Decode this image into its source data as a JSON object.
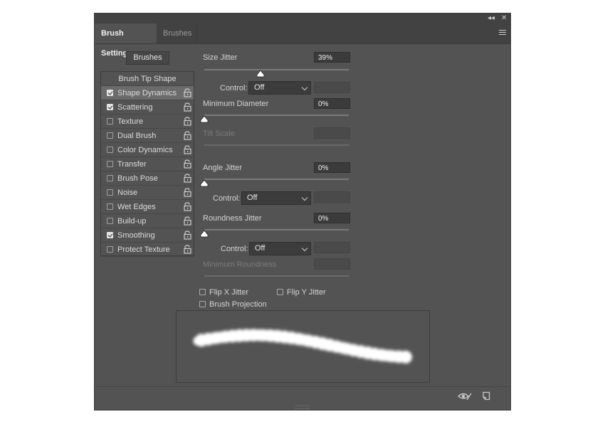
{
  "window": {
    "collapse_glyph": "◂◂",
    "close_glyph": "✕"
  },
  "tabs": [
    {
      "label": "Brush Settings",
      "active": true
    },
    {
      "label": "Brushes",
      "active": false
    }
  ],
  "brushes_button": "Brushes",
  "tip_shape_label": "Brush Tip Shape",
  "options": [
    {
      "label": "Shape Dynamics",
      "checked": true,
      "selected": true
    },
    {
      "label": "Scattering",
      "checked": true
    },
    {
      "label": "Texture",
      "checked": false
    },
    {
      "label": "Dual Brush",
      "checked": false
    },
    {
      "label": "Color Dynamics",
      "checked": false
    },
    {
      "label": "Transfer",
      "checked": false
    },
    {
      "label": "Brush Pose",
      "checked": false
    },
    {
      "label": "Noise",
      "checked": false
    },
    {
      "label": "Wet Edges",
      "checked": false
    },
    {
      "label": "Build-up",
      "checked": false
    },
    {
      "label": "Smoothing",
      "checked": true
    },
    {
      "label": "Protect Texture",
      "checked": false
    }
  ],
  "settings": {
    "size_jitter": {
      "label": "Size Jitter",
      "value": "39%",
      "level": 0.39
    },
    "size_control": {
      "label": "Control:",
      "value": "Off"
    },
    "minimum_diameter": {
      "label": "Minimum Diameter",
      "value": "0%",
      "level": 0
    },
    "tilt_scale": {
      "label": "Tilt Scale"
    },
    "angle_jitter": {
      "label": "Angle Jitter",
      "value": "0%",
      "level": 0
    },
    "angle_control": {
      "label": "Control:",
      "value": "Off"
    },
    "roundness_jitter": {
      "label": "Roundness Jitter",
      "value": "0%",
      "level": 0
    },
    "roundness_control": {
      "label": "Control:",
      "value": "Off"
    },
    "minimum_roundness": {
      "label": "Minimum Roundness"
    }
  },
  "flip_x": {
    "label": "Flip X Jitter",
    "checked": false
  },
  "flip_y": {
    "label": "Flip Y Jitter",
    "checked": false
  },
  "brush_projection": {
    "label": "Brush Projection",
    "checked": false
  },
  "colors": {
    "panel": "#535353",
    "header": "#424242",
    "field": "#3b3b3b",
    "selected_row": "#6b6b6b"
  },
  "icons": [
    "menu-icon",
    "lock-icon",
    "eye-icon",
    "new-preset-icon",
    "chevron-down-icon"
  ]
}
